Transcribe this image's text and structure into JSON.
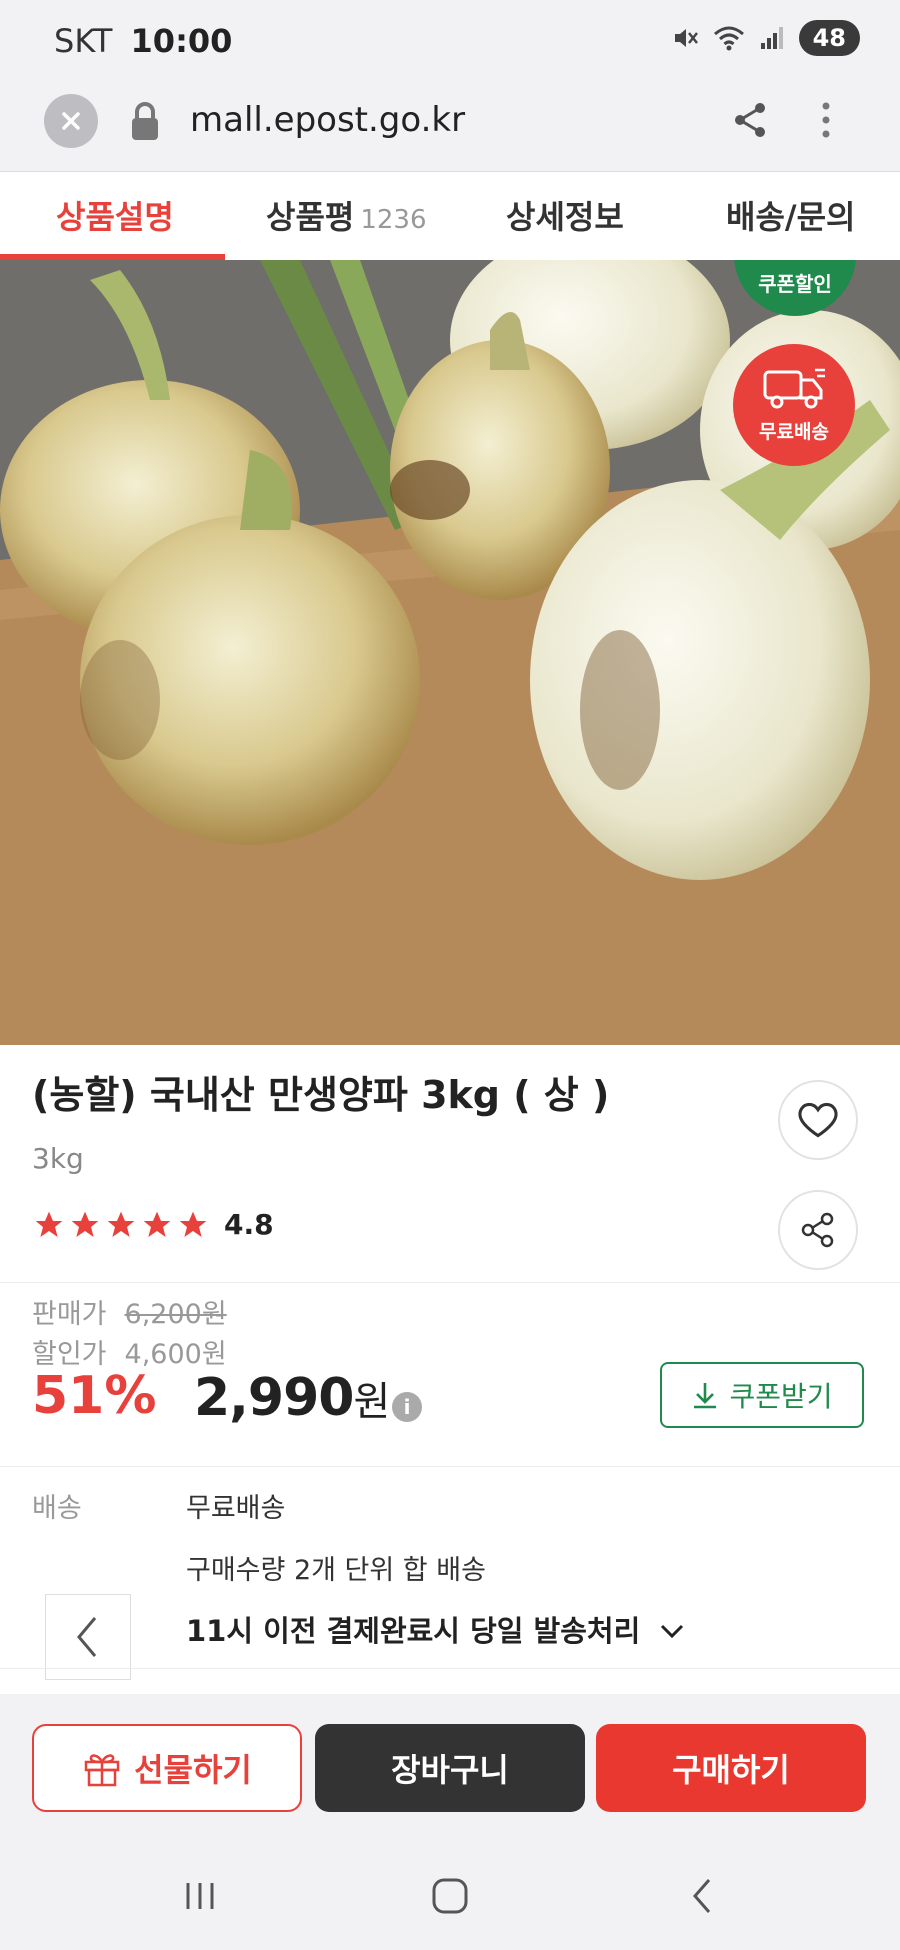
{
  "status_bar": {
    "carrier": "SKT",
    "time": "10:00",
    "battery": "48"
  },
  "browser": {
    "url": "mall.epost.go.kr"
  },
  "tabs": [
    {
      "label": "상품설명",
      "active": true
    },
    {
      "label": "상품평",
      "count": "1236"
    },
    {
      "label": "상세정보"
    },
    {
      "label": "배송/문의"
    }
  ],
  "badges": {
    "coupon": "쿠폰할인",
    "free_shipping": "무료배송"
  },
  "product": {
    "title": "(농할) 국내산 만생양파 3kg ( 상 )",
    "subtitle": "3kg",
    "rating": "4.8",
    "stars": 5
  },
  "price": {
    "sale_label": "판매가",
    "sale_price": "6,200원",
    "discount_label": "할인가",
    "discount_price": "4,600원",
    "discount_rate": "51%",
    "final_price": "2,990",
    "final_unit": "원",
    "info_glyph": "i",
    "coupon_button": "쿠폰받기"
  },
  "shipping": {
    "label": "배송",
    "line1": "무료배송",
    "line2": "구매수량 2개 단위 합 배송",
    "line3": "11시 이전 결제완료시 당일 발송처리"
  },
  "actions": {
    "gift": "선물하기",
    "cart": "장바구니",
    "buy": "구매하기"
  },
  "colors": {
    "accent_red": "#e8403a",
    "coupon_green": "#1f8a4c",
    "cart_dark": "#333333"
  }
}
